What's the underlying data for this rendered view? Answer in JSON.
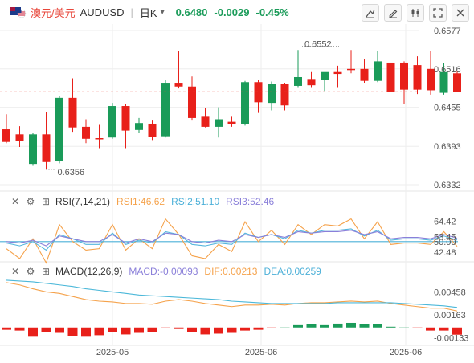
{
  "header": {
    "flag_icon": "au-us-flag-icon",
    "symbol_cn": "澳元/美元",
    "symbol_code": "AUDUSD",
    "timeframe": "日K",
    "last_price": "0.6480",
    "change": "-0.0029",
    "change_pct": "-0.45%"
  },
  "toolbar": [
    "draw-icon",
    "edit-icon",
    "indicator-icon",
    "fullscreen-icon",
    "close-icon"
  ],
  "colors": {
    "up": "#1a9b59",
    "down": "#e8201a",
    "grid": "#eeeeee",
    "axis_text": "#555555"
  },
  "chart_data": [
    {
      "type": "candlestick",
      "axis_ticks": [
        "0.6577",
        "0.6516",
        "0.6455",
        "0.6393",
        "0.6332"
      ],
      "ylim": [
        0.6332,
        0.6577
      ],
      "x_labels": [
        "2025-05",
        "2025-06",
        "2025-06"
      ],
      "annotations": {
        "high": "0.6552",
        "low": "0.6356"
      },
      "candles": [
        {
          "o": 0.642,
          "h": 0.6444,
          "l": 0.6398,
          "c": 0.64
        },
        {
          "o": 0.6412,
          "h": 0.6425,
          "l": 0.6392,
          "c": 0.6401
        },
        {
          "o": 0.6365,
          "h": 0.6415,
          "l": 0.6362,
          "c": 0.6412
        },
        {
          "o": 0.6412,
          "h": 0.6448,
          "l": 0.6356,
          "c": 0.6368
        },
        {
          "o": 0.6369,
          "h": 0.6473,
          "l": 0.6366,
          "c": 0.647
        },
        {
          "o": 0.647,
          "h": 0.6501,
          "l": 0.6416,
          "c": 0.6423
        },
        {
          "o": 0.6424,
          "h": 0.6436,
          "l": 0.6398,
          "c": 0.6405
        },
        {
          "o": 0.6406,
          "h": 0.6427,
          "l": 0.639,
          "c": 0.6405
        },
        {
          "o": 0.6407,
          "h": 0.6462,
          "l": 0.6405,
          "c": 0.6457
        },
        {
          "o": 0.6457,
          "h": 0.646,
          "l": 0.639,
          "c": 0.6418
        },
        {
          "o": 0.6419,
          "h": 0.6438,
          "l": 0.6414,
          "c": 0.643
        },
        {
          "o": 0.6429,
          "h": 0.6434,
          "l": 0.6403,
          "c": 0.6408
        },
        {
          "o": 0.6409,
          "h": 0.6498,
          "l": 0.6407,
          "c": 0.6494
        },
        {
          "o": 0.6494,
          "h": 0.6544,
          "l": 0.6485,
          "c": 0.6488
        },
        {
          "o": 0.6488,
          "h": 0.6504,
          "l": 0.6434,
          "c": 0.6438
        },
        {
          "o": 0.644,
          "h": 0.6454,
          "l": 0.6423,
          "c": 0.6424
        },
        {
          "o": 0.6424,
          "h": 0.6455,
          "l": 0.6407,
          "c": 0.6436
        },
        {
          "o": 0.6432,
          "h": 0.644,
          "l": 0.6424,
          "c": 0.6428
        },
        {
          "o": 0.6428,
          "h": 0.6497,
          "l": 0.6426,
          "c": 0.6495
        },
        {
          "o": 0.6495,
          "h": 0.6498,
          "l": 0.6446,
          "c": 0.6463
        },
        {
          "o": 0.6462,
          "h": 0.6496,
          "l": 0.645,
          "c": 0.6492
        },
        {
          "o": 0.6492,
          "h": 0.6494,
          "l": 0.645,
          "c": 0.6458
        },
        {
          "o": 0.6489,
          "h": 0.6546,
          "l": 0.6487,
          "c": 0.6503
        },
        {
          "o": 0.65,
          "h": 0.6511,
          "l": 0.6487,
          "c": 0.649
        },
        {
          "o": 0.6498,
          "h": 0.651,
          "l": 0.6481,
          "c": 0.6511
        },
        {
          "o": 0.6511,
          "h": 0.6521,
          "l": 0.6487,
          "c": 0.6508
        },
        {
          "o": 0.6516,
          "h": 0.6546,
          "l": 0.6509,
          "c": 0.6515
        },
        {
          "o": 0.6516,
          "h": 0.6531,
          "l": 0.6494,
          "c": 0.6497
        },
        {
          "o": 0.6497,
          "h": 0.6545,
          "l": 0.6495,
          "c": 0.6528
        },
        {
          "o": 0.6526,
          "h": 0.6526,
          "l": 0.648,
          "c": 0.648
        },
        {
          "o": 0.6526,
          "h": 0.6528,
          "l": 0.646,
          "c": 0.6483
        },
        {
          "o": 0.6522,
          "h": 0.6536,
          "l": 0.6476,
          "c": 0.6483
        },
        {
          "o": 0.6516,
          "h": 0.6544,
          "l": 0.6475,
          "c": 0.6482
        },
        {
          "o": 0.6478,
          "h": 0.6526,
          "l": 0.6475,
          "c": 0.6511
        },
        {
          "o": 0.6509,
          "h": 0.6512,
          "l": 0.648,
          "c": 0.648
        }
      ]
    },
    {
      "type": "line",
      "label": "RSI(7,14,21)",
      "legend": [
        "RSI1:46.62",
        "RSI2:51.10",
        "RSI3:52.46"
      ],
      "axis_ticks": [
        "64.42",
        "53.45",
        "50.00",
        "42.48"
      ],
      "ylim": [
        38,
        72
      ],
      "reference": 50,
      "series": [
        {
          "name": "RSI1",
          "color": "#f5a24b",
          "values": [
            45,
            38,
            52,
            35,
            62,
            50,
            44,
            45,
            62,
            44,
            52,
            45,
            66,
            55,
            40,
            38,
            48,
            43,
            64,
            50,
            58,
            48,
            62,
            55,
            62,
            61,
            66,
            52,
            64,
            48,
            49,
            49,
            48,
            57,
            46.62
          ]
        },
        {
          "name": "RSI2",
          "color": "#55b6dd",
          "values": [
            49,
            47,
            50,
            44,
            55,
            52,
            48,
            48,
            56,
            48,
            51,
            49,
            57,
            55,
            48,
            47,
            49,
            48,
            56,
            53,
            55,
            52,
            58,
            56,
            58,
            58,
            59,
            54,
            58,
            51,
            52,
            52,
            51,
            54,
            51.1
          ]
        },
        {
          "name": "RSI3",
          "color": "#8a7fd9",
          "values": [
            50,
            49,
            51,
            47,
            54,
            52,
            50,
            50,
            55,
            49,
            52,
            50,
            56,
            55,
            50,
            49,
            51,
            50,
            55,
            53,
            55,
            53,
            57,
            56,
            57,
            57,
            58,
            55,
            57,
            52,
            53,
            53,
            52,
            55,
            52.46
          ]
        }
      ]
    },
    {
      "type": "bar+line",
      "label": "MACD(12,26,9)",
      "legend": [
        "MACD:-0.00093",
        "DIF:0.00213",
        "DEA:0.00259"
      ],
      "axis_ticks": [
        "0.00458",
        "0.00163",
        "-0.00133"
      ],
      "ylim": [
        -0.0021,
        0.0062
      ],
      "macd": [
        -0.0003,
        -0.0004,
        -0.0012,
        -0.0006,
        -0.0007,
        -0.0011,
        -0.0012,
        -0.001,
        -0.0006,
        -0.0009,
        -0.0007,
        -0.0006,
        -0.0001,
        -0.0002,
        -0.0006,
        -0.0009,
        -0.0008,
        -0.0007,
        -0.0004,
        -0.0003,
        -0.0001,
        0.0,
        0.0003,
        0.0004,
        0.0003,
        0.0005,
        0.0006,
        0.0004,
        0.0004,
        0.0001,
        0.0,
        -0.0001,
        -0.0004,
        -0.0004,
        -0.00093
      ],
      "dif": [
        0.0058,
        0.0055,
        0.005,
        0.0046,
        0.0044,
        0.004,
        0.0036,
        0.0034,
        0.0033,
        0.0031,
        0.0031,
        0.003,
        0.0034,
        0.0036,
        0.0034,
        0.0031,
        0.0029,
        0.0027,
        0.0029,
        0.0029,
        0.003,
        0.0029,
        0.0031,
        0.0032,
        0.0032,
        0.0033,
        0.0034,
        0.0033,
        0.0034,
        0.0031,
        0.0029,
        0.0027,
        0.0025,
        0.0025,
        0.00213
      ],
      "dea": [
        0.0061,
        0.006,
        0.0059,
        0.0057,
        0.0055,
        0.0053,
        0.005,
        0.0048,
        0.0046,
        0.0044,
        0.0042,
        0.0041,
        0.004,
        0.0039,
        0.0038,
        0.0037,
        0.0036,
        0.0034,
        0.0033,
        0.0032,
        0.0031,
        0.0031,
        0.0031,
        0.0031,
        0.0031,
        0.0032,
        0.0032,
        0.0032,
        0.0032,
        0.0032,
        0.0031,
        0.003,
        0.0029,
        0.0028,
        0.00259
      ],
      "dif_color": "#f5a24b",
      "dea_color": "#4cb8d9"
    }
  ]
}
